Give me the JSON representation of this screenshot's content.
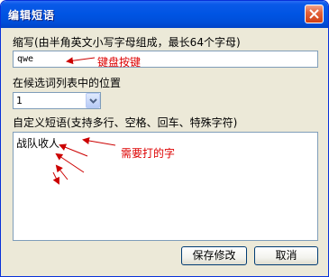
{
  "window": {
    "title": "编辑短语"
  },
  "abbrev": {
    "label": "缩写(由半角英文小写字母组成，最长64个字母)",
    "value": "qwe",
    "annotation": "键盘按键"
  },
  "position": {
    "label": "在候选词列表中的位置",
    "selected": "1"
  },
  "phrase": {
    "label": "自定义短语(支持多行、空格、回车、特殊字符)",
    "value": "战队收人",
    "annotation": "需要打的字"
  },
  "buttons": {
    "save": "保存修改",
    "cancel": "取消"
  },
  "icons": {
    "close": "close-icon",
    "dropdown": "chevron-down-icon"
  },
  "colors": {
    "titlebar": "#0054e3",
    "annotation": "#dd0000",
    "dialog_bg": "#ece9d8"
  }
}
